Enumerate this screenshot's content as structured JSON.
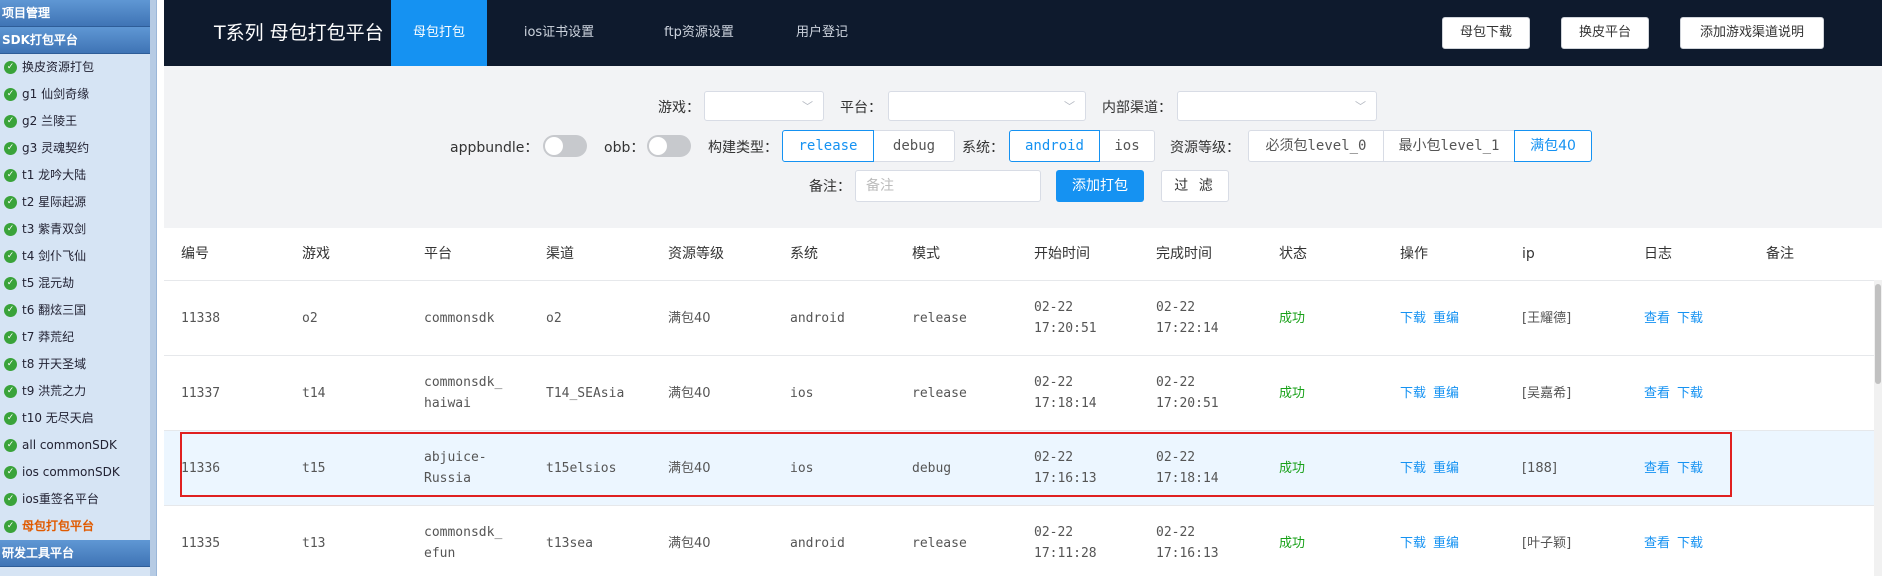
{
  "sidebar": {
    "headers": [
      "项目管理",
      "SDK打包平台",
      "研发工具平台"
    ],
    "items": [
      {
        "label": "换皮资源打包"
      },
      {
        "label": "g1 仙剑奇缘"
      },
      {
        "label": "g2 兰陵王"
      },
      {
        "label": "g3 灵魂契约"
      },
      {
        "label": "t1 龙吟大陆"
      },
      {
        "label": "t2 星际起源"
      },
      {
        "label": "t3 紫青双剑"
      },
      {
        "label": "t4 剑仆飞仙"
      },
      {
        "label": "t5 混元劫"
      },
      {
        "label": "t6 翻炫三国"
      },
      {
        "label": "t7 莽荒纪"
      },
      {
        "label": "t8 开天圣域"
      },
      {
        "label": "t9 洪荒之力"
      },
      {
        "label": "t10 无尽天启"
      },
      {
        "label": "all commonSDK"
      },
      {
        "label": "ios commonSDK"
      },
      {
        "label": "ios重签名平台"
      },
      {
        "label": "母包打包平台",
        "active": true
      }
    ]
  },
  "topbar": {
    "title": "T系列 母包打包平台",
    "tabs": [
      {
        "label": "母包打包",
        "active": true
      },
      {
        "label": "ios证书设置"
      },
      {
        "label": "ftp资源设置"
      },
      {
        "label": "用户登记"
      }
    ],
    "buttons": [
      "母包下载",
      "换皮平台",
      "添加游戏渠道说明"
    ]
  },
  "filters": {
    "game_label": "游戏：",
    "platform_label": "平台：",
    "channel_label": "内部渠道：",
    "appbundle_label": "appbundle：",
    "obb_label": "obb：",
    "build_type_label": "构建类型：",
    "build_types": [
      "release",
      "debug"
    ],
    "build_type_selected": "release",
    "system_label": "系统：",
    "systems": [
      "android",
      "ios"
    ],
    "system_selected": "android",
    "resource_label": "资源等级：",
    "resource_levels": [
      "必须包level_0",
      "最小包level_1",
      "满包40"
    ],
    "resource_selected": "满包40",
    "remark_label": "备注：",
    "remark_placeholder": "备注",
    "add_button": "添加打包",
    "filter_button": "过 滤"
  },
  "table": {
    "columns": [
      "编号",
      "游戏",
      "平台",
      "渠道",
      "资源等级",
      "系统",
      "模式",
      "开始时间",
      "完成时间",
      "状态",
      "操作",
      "ip",
      "日志",
      "备注"
    ],
    "rows": [
      {
        "id": "11338",
        "game": "o2",
        "platform": "commonsdk",
        "channel": "o2",
        "resource": "满包40",
        "system": "android",
        "mode": "release",
        "start": "02-22\n17:20:51",
        "end": "02-22\n17:22:14",
        "status": "成功",
        "ops": [
          "下载",
          "重编"
        ],
        "ip": "[王耀德]",
        "log": [
          "查看",
          "下载"
        ],
        "remark": ""
      },
      {
        "id": "11337",
        "game": "t14",
        "platform": "commonsdk_\nhaiwai",
        "channel": "T14_SEAsia",
        "resource": "满包40",
        "system": "ios",
        "mode": "release",
        "start": "02-22\n17:18:14",
        "end": "02-22\n17:20:51",
        "status": "成功",
        "ops": [
          "下载",
          "重编"
        ],
        "ip": "[吴嘉希]",
        "log": [
          "查看",
          "下载"
        ],
        "remark": ""
      },
      {
        "id": "11336",
        "game": "t15",
        "platform": "abjuice-\nRussia",
        "channel": "t15elsios",
        "resource": "满包40",
        "system": "ios",
        "mode": "debug",
        "start": "02-22\n17:16:13",
        "end": "02-22\n17:18:14",
        "status": "成功",
        "ops": [
          "下载",
          "重编"
        ],
        "ip": "[188]",
        "log": [
          "查看",
          "下载"
        ],
        "remark": "",
        "highlighted": true
      },
      {
        "id": "11335",
        "game": "t13",
        "platform": "commonsdk_\nefun",
        "channel": "t13sea",
        "resource": "满包40",
        "system": "android",
        "mode": "release",
        "start": "02-22\n17:11:28",
        "end": "02-22\n17:16:13",
        "status": "成功",
        "ops": [
          "下载",
          "重编"
        ],
        "ip": "[叶子颖]",
        "log": [
          "查看",
          "下载"
        ],
        "remark": ""
      }
    ]
  },
  "colors": {
    "accent": "#1592f2",
    "topbar": "#0e1a2d",
    "success": "#19a119",
    "highlight_border": "#e02020",
    "highlight_row": "#ecf6ff"
  }
}
